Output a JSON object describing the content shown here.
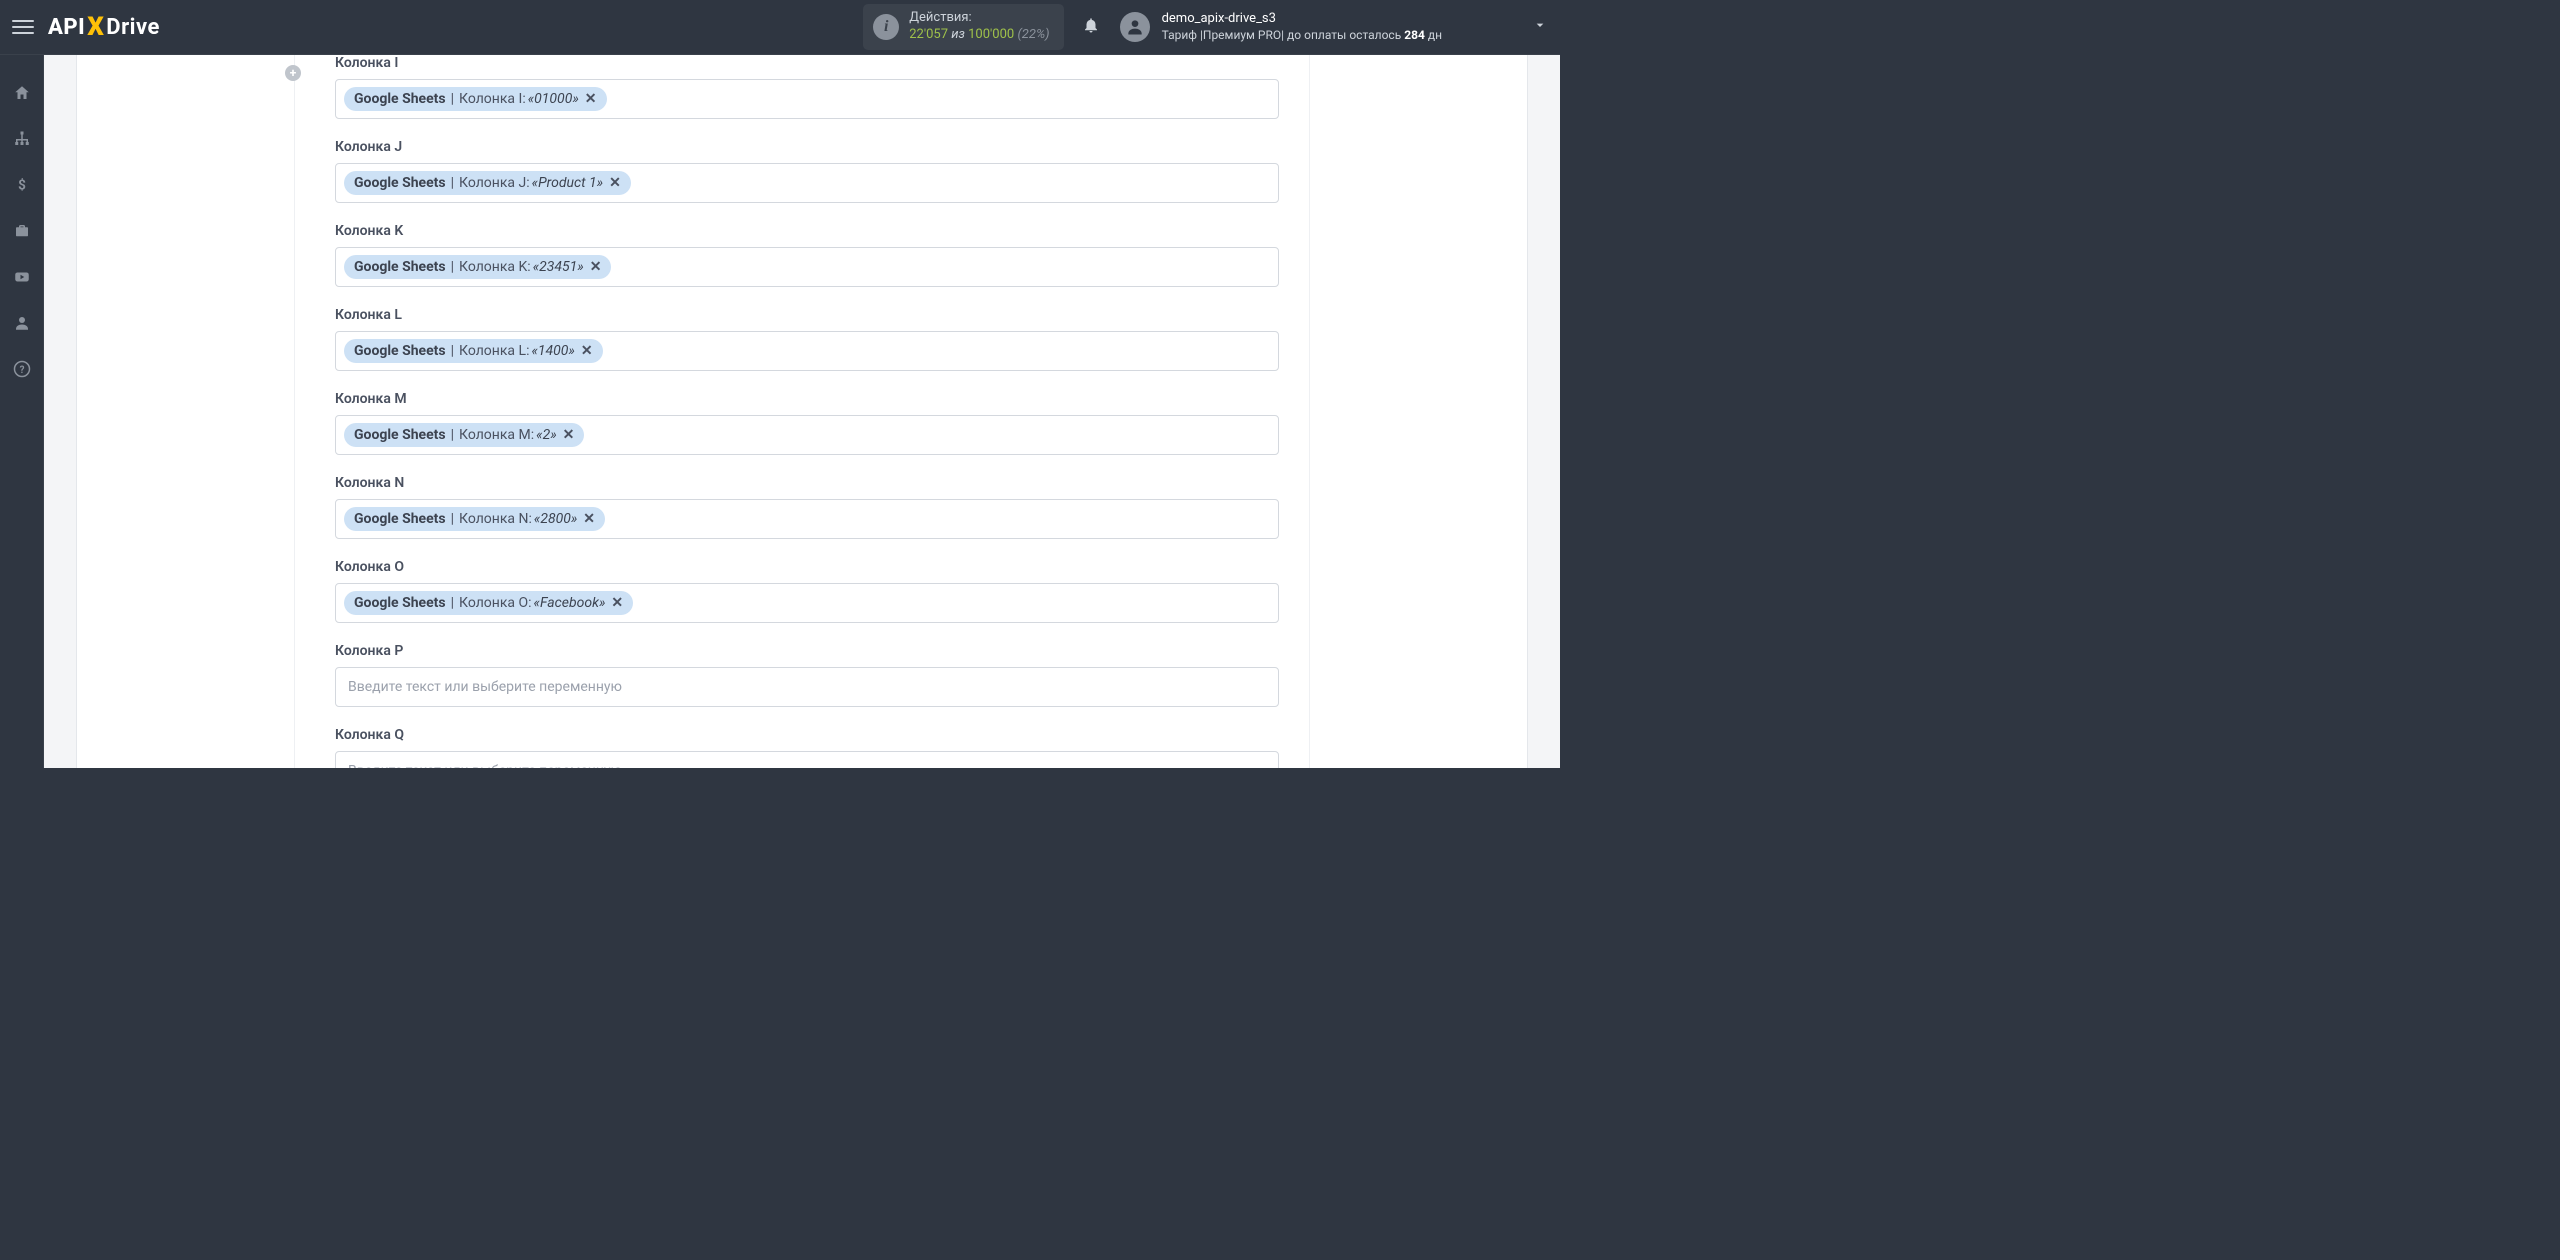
{
  "header": {
    "logo_api": "API",
    "logo_x": "X",
    "logo_drive": "Drive",
    "actions_label": "Действия:",
    "actions_used": "22'057",
    "actions_of": " из ",
    "actions_total": "100'000",
    "actions_pct": "(22%)",
    "username": "demo_apix-drive_s3",
    "tariff_prefix": "Тариф |Премиум PRO|  до оплаты осталось ",
    "tariff_days": "284",
    "tariff_suffix": " дн"
  },
  "placeholder": "Введите текст или выберите переменную",
  "fields": [
    {
      "label": "Колонка I",
      "src": "Google Sheets",
      "col": "Колонка I:",
      "val": "«01000»"
    },
    {
      "label": "Колонка J",
      "src": "Google Sheets",
      "col": "Колонка J:",
      "val": "«Product 1»"
    },
    {
      "label": "Колонка K",
      "src": "Google Sheets",
      "col": "Колонка K:",
      "val": "«23451»"
    },
    {
      "label": "Колонка L",
      "src": "Google Sheets",
      "col": "Колонка L:",
      "val": "«1400»"
    },
    {
      "label": "Колонка M",
      "src": "Google Sheets",
      "col": "Колонка M:",
      "val": "«2»"
    },
    {
      "label": "Колонка N",
      "src": "Google Sheets",
      "col": "Колонка N:",
      "val": "«2800»"
    },
    {
      "label": "Колонка O",
      "src": "Google Sheets",
      "col": "Колонка O:",
      "val": "«Facebook»"
    },
    {
      "label": "Колонка P",
      "empty": true
    },
    {
      "label": "Колонка Q",
      "empty": true
    }
  ]
}
